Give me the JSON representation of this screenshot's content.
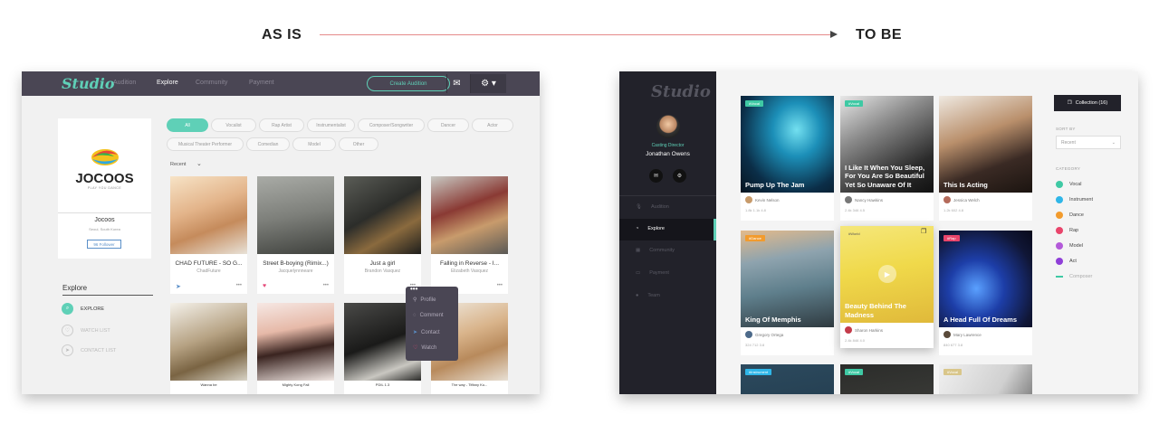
{
  "headings": {
    "as_is": "AS IS",
    "to_be": "TO BE"
  },
  "as_is": {
    "logo": "Studio",
    "nav": [
      "Audition",
      "Explore",
      "Community",
      "Payment"
    ],
    "create_button": "Create Audition",
    "profile": {
      "brand": "JOCOOS",
      "brand_tagline": "PLAY YOU DANCE",
      "name": "Jocoos",
      "location": "Seoul, South Korea",
      "follow": "96 Follower"
    },
    "explore_heading": "Explore",
    "explore_items": [
      "EXPLORE",
      "WATCH LIST",
      "CONTACT LIST"
    ],
    "filters_row1": [
      "All",
      "Vocalist",
      "Rap Artist",
      "Instrumentalist",
      "Composer/Songwriter",
      "Dancer",
      "Actor"
    ],
    "filters_row2": [
      "Musical Theater Performer",
      "Comedian",
      "Model",
      "Other"
    ],
    "sort": "Recent",
    "cards": [
      {
        "title": "CHAD FUTURE - SO G...",
        "sub": "ChadFuture",
        "icon": "send-icon",
        "color": "#5a8fc8"
      },
      {
        "title": "Street B-boying (Rimix...)",
        "sub": "Jacquelynnneare",
        "icon": "heart-icon",
        "color": "#e44b7a"
      },
      {
        "title": "Just a girl",
        "sub": "Brandon Vasquez",
        "icon": "",
        "color": ""
      },
      {
        "title": "Falling in Reverse - I...",
        "sub": "Elizabeth Vasquez",
        "icon": "",
        "color": ""
      }
    ],
    "cards_row2": [
      "Wanna be",
      "Mighty Kong Fall",
      "PDIL 1.3",
      "The way - Tiffany Ku..."
    ],
    "popup": [
      "Profile",
      "Comment",
      "Contact",
      "Watch"
    ]
  },
  "to_be": {
    "logo": "Studio",
    "role": "Casting Director",
    "name": "Jonathan Owens",
    "nav": [
      "Audition",
      "Explore",
      "Community",
      "Payment",
      "Team"
    ],
    "active_nav": "Explore",
    "collection_button": "Collection (16)",
    "sort_label": "SORT BY",
    "sort_value": "Recent",
    "category_label": "CATEGORY",
    "categories": [
      {
        "label": "Vocal",
        "color": "#3fc9a4"
      },
      {
        "label": "Instrument",
        "color": "#2fb6e8"
      },
      {
        "label": "Dance",
        "color": "#f29b2d"
      },
      {
        "label": "Rap",
        "color": "#e9456b"
      },
      {
        "label": "Model",
        "color": "#b35ad9"
      },
      {
        "label": "Act",
        "color": "#8f3fd8"
      },
      {
        "label": "Composer",
        "color": "#3fc9a4"
      }
    ],
    "cards": [
      {
        "tag": "#Vocal",
        "title": "Pump Up The Jam",
        "user": "Kevin Nelson",
        "stats": "1.8k  1.1k  4.8"
      },
      {
        "tag": "#Vocal",
        "title": "I Like It When You Sleep, For You Are So Beautiful Yet So Unaware Of It",
        "user": "Nancy Hawkins",
        "stats": "2.4k  346  4.5"
      },
      {
        "tag": "",
        "title": "This Is Acting",
        "user": "Jessica Welch",
        "stats": "1.2k  602  4.8"
      },
      {
        "tag": "#Dance",
        "title": "King Of Memphis",
        "user": "Gregory Ortega",
        "stats": "324  712  3.8"
      },
      {
        "tag": "#World",
        "title": "Beauty Behind The Madness",
        "user": "Sharon Harkins",
        "stats": "2.4k  846  4.0"
      },
      {
        "tag": "#Rap",
        "title": "A Head Full Of Dreams",
        "user": "Mary Lawrence",
        "stats": "840  677  3.8"
      }
    ],
    "row3_tags": [
      "#Instrument",
      "#Vocal",
      "#Vocal"
    ]
  }
}
